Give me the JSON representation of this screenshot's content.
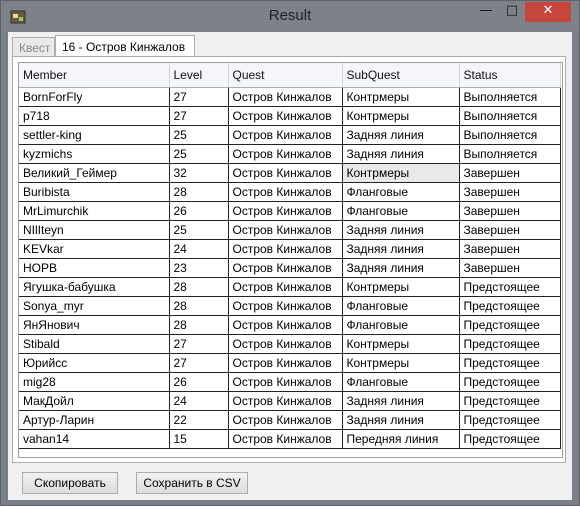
{
  "window": {
    "title": "Result"
  },
  "tabs": [
    {
      "label": "Квест"
    },
    {
      "label": "16 - Остров Кинжалов"
    }
  ],
  "table": {
    "columns": [
      "Member",
      "Level",
      "Quest",
      "SubQuest",
      "Status"
    ],
    "rows": [
      [
        "BornForFly",
        "27",
        "Остров Кинжалов",
        "Контрмеры",
        "Выполняется"
      ],
      [
        "p718",
        "27",
        "Остров Кинжалов",
        "Контрмеры",
        "Выполняется"
      ],
      [
        "settler-king",
        "25",
        "Остров Кинжалов",
        "Задняя линия",
        "Выполняется"
      ],
      [
        "kyzmichs",
        "25",
        "Остров Кинжалов",
        "Задняя линия",
        "Выполняется"
      ],
      [
        "Великий_Геймер",
        "32",
        "Остров Кинжалов",
        "Контрмеры",
        "Завершен"
      ],
      [
        "Buribista",
        "28",
        "Остров Кинжалов",
        "Фланговые",
        "Завершен"
      ],
      [
        "MrLimurchik",
        "26",
        "Остров Кинжалов",
        "Фланговые",
        "Завершен"
      ],
      [
        "NIlIteyn",
        "25",
        "Остров Кинжалов",
        "Задняя линия",
        "Завершен"
      ],
      [
        "KEVkar",
        "24",
        "Остров Кинжалов",
        "Задняя линия",
        "Завершен"
      ],
      [
        "НОРВ",
        "23",
        "Остров Кинжалов",
        "Задняя линия",
        "Завершен"
      ],
      [
        "Ягушка-бабушка",
        "28",
        "Остров Кинжалов",
        "Контрмеры",
        "Предстоящее"
      ],
      [
        "Sonya_myr",
        "28",
        "Остров Кинжалов",
        "Фланговые",
        "Предстоящее"
      ],
      [
        "ЯнЯнович",
        "28",
        "Остров Кинжалов",
        "Фланговые",
        "Предстоящее"
      ],
      [
        "Stibald",
        "27",
        "Остров Кинжалов",
        "Контрмеры",
        "Предстоящее"
      ],
      [
        "Юрийсс",
        "27",
        "Остров Кинжалов",
        "Контрмеры",
        "Предстоящее"
      ],
      [
        "mig28",
        "26",
        "Остров Кинжалов",
        "Фланговые",
        "Предстоящее"
      ],
      [
        "МакДойл",
        "24",
        "Остров Кинжалов",
        "Задняя линия",
        "Предстоящее"
      ],
      [
        "Артур-Ларин",
        "22",
        "Остров Кинжалов",
        "Задняя линия",
        "Предстоящее"
      ],
      [
        "vahan14",
        "15",
        "Остров Кинжалов",
        "Передняя линия",
        "Предстоящее"
      ]
    ]
  },
  "buttons": {
    "copy": "Скопировать",
    "save_csv": "Сохранить в CSV"
  },
  "icons": {
    "app": "app-icon",
    "minimize": "minimize-icon",
    "maximize": "maximize-icon",
    "close": "close-icon"
  },
  "colors": {
    "close_button": "#c7463c",
    "titlebar": "#7c818a"
  }
}
